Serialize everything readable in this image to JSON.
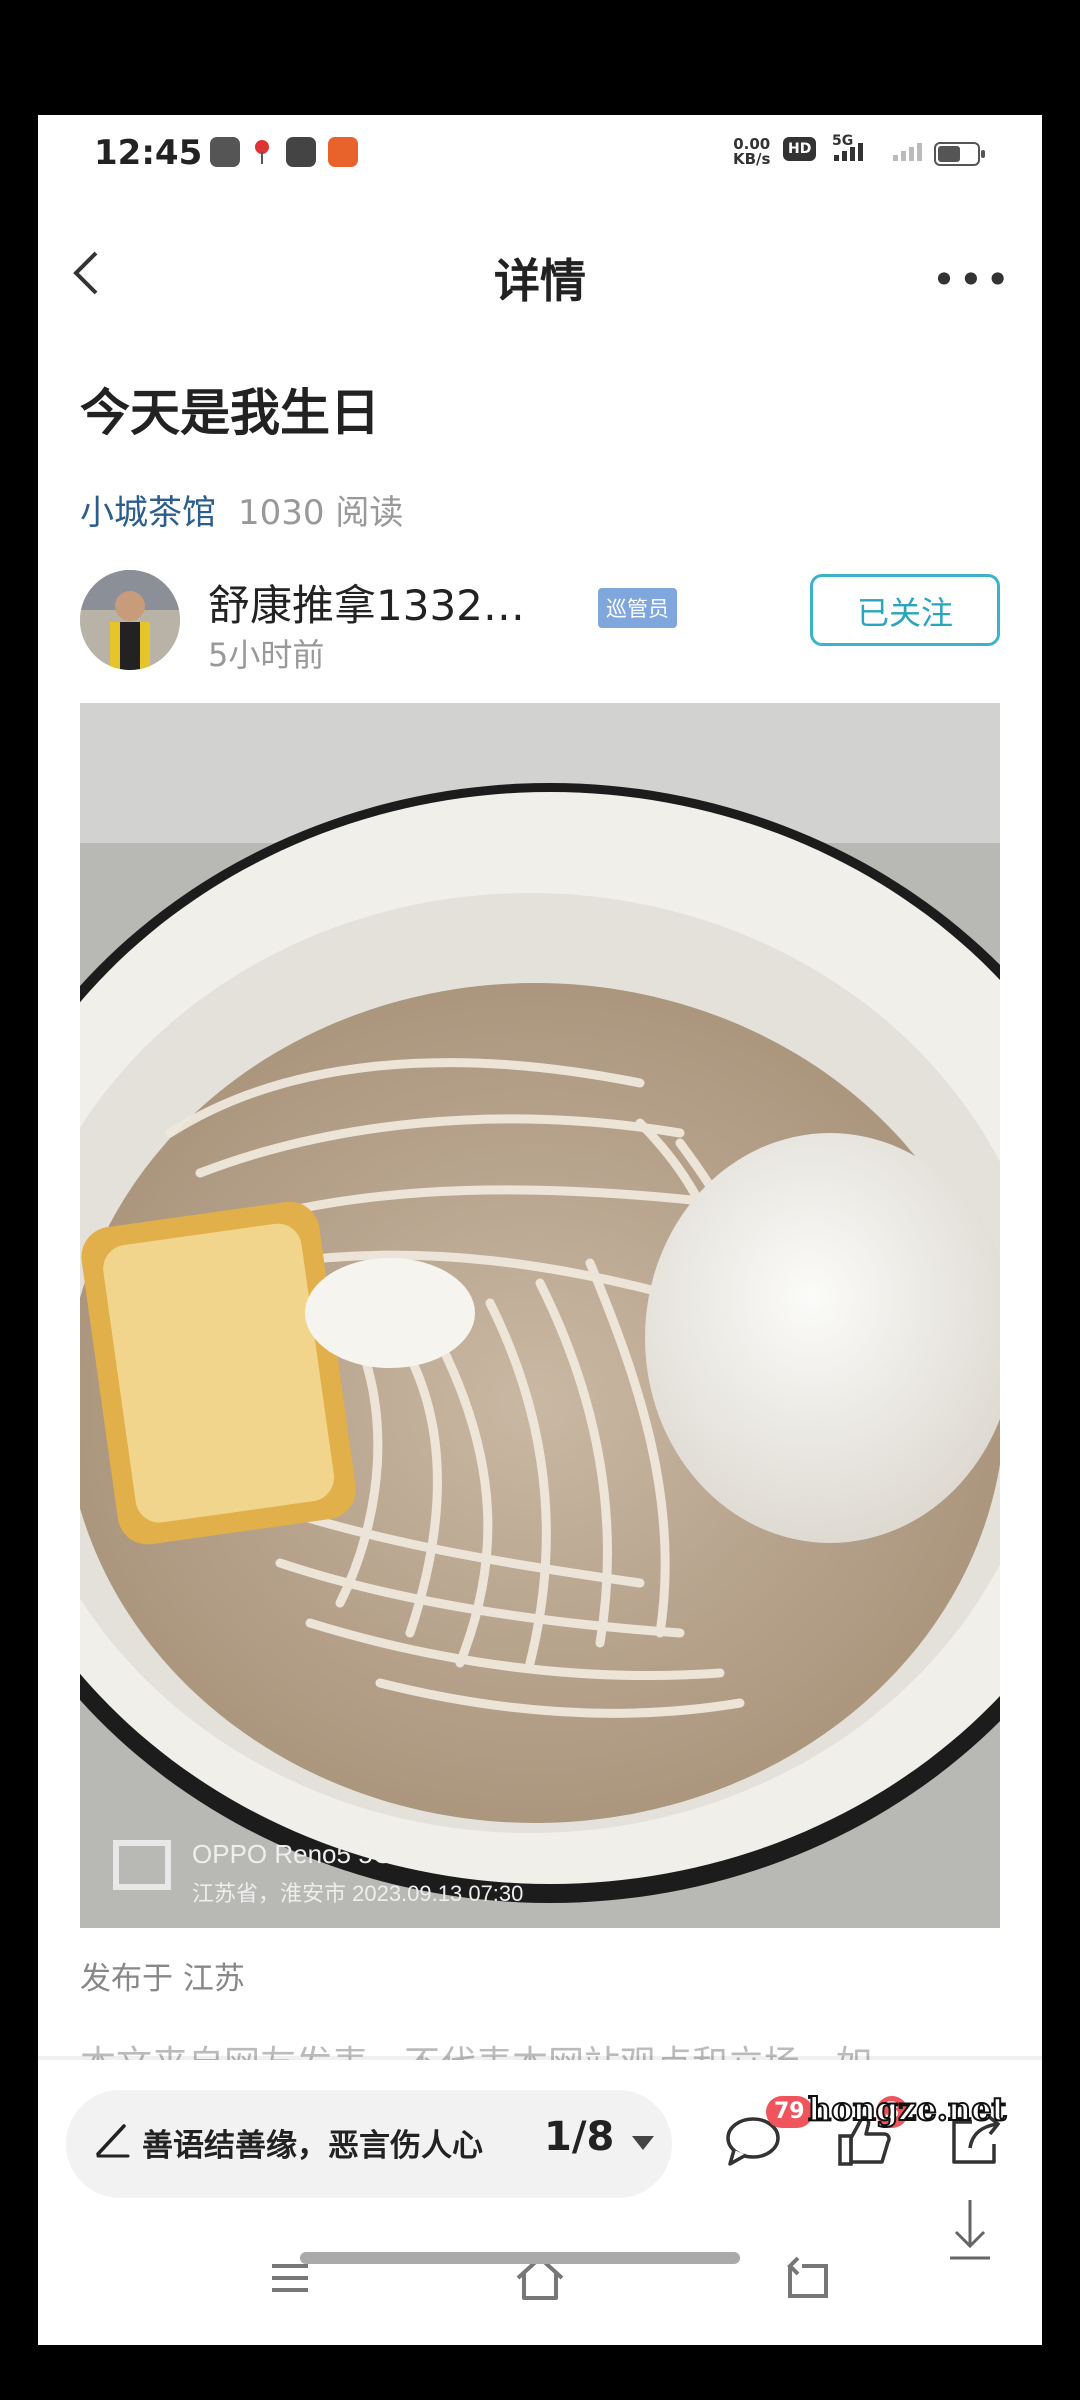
{
  "status_bar": {
    "time": "12:45",
    "net_speed_value": "0.00",
    "net_speed_unit": "KB/s",
    "hd": "HD",
    "signal": "5G"
  },
  "header": {
    "title": "详情"
  },
  "post": {
    "title": "今天是我生日",
    "channel": "小城茶馆",
    "reads": "1030 阅读",
    "author": {
      "name": "舒康推拿1332…",
      "badge": "巡管员",
      "time_ago": "5小时前",
      "follow_label": "已关注"
    },
    "image": {
      "camera": "OPPO Reno5 5G",
      "caption": "江苏省，淮安市 2023.09.13 07:30"
    },
    "location": "发布于 江苏",
    "disclaimer": "本文来自网友发表，不代表本网站观点和立场，如"
  },
  "bottom_bar": {
    "compose_placeholder": "善语结善缘，恶言伤人心",
    "page_indicator": "1/8",
    "comment_count": "79",
    "like_count": "3"
  },
  "watermark": "hongze.net",
  "colors": {
    "accent": "#2aa5bd",
    "channel": "#2b5e8c",
    "badge": "#f0555d"
  }
}
